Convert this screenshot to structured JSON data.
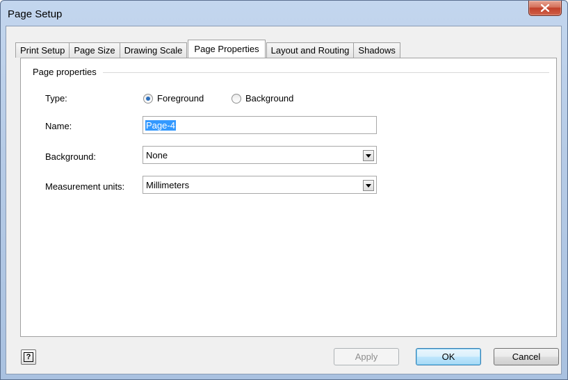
{
  "window": {
    "title": "Page Setup"
  },
  "tabs": [
    {
      "label": "Print Setup"
    },
    {
      "label": "Page Size"
    },
    {
      "label": "Drawing Scale"
    },
    {
      "label": "Page Properties"
    },
    {
      "label": "Layout and Routing"
    },
    {
      "label": "Shadows"
    }
  ],
  "active_tab": "Page Properties",
  "group": {
    "label": "Page properties"
  },
  "type": {
    "label": "Type:",
    "options": [
      {
        "label": "Foreground",
        "checked": true
      },
      {
        "label": "Background",
        "checked": false
      }
    ]
  },
  "name": {
    "label": "Name:",
    "value": "Page-4"
  },
  "background": {
    "label": "Background:",
    "value": "None"
  },
  "units": {
    "label": "Measurement units:",
    "value": "Millimeters"
  },
  "buttons": {
    "apply": "Apply",
    "ok": "OK",
    "cancel": "Cancel",
    "help": "?"
  },
  "colors": {
    "selection": "#3399ff",
    "title_gradient": "#b6cbe6",
    "close_red": "#c1402a"
  }
}
